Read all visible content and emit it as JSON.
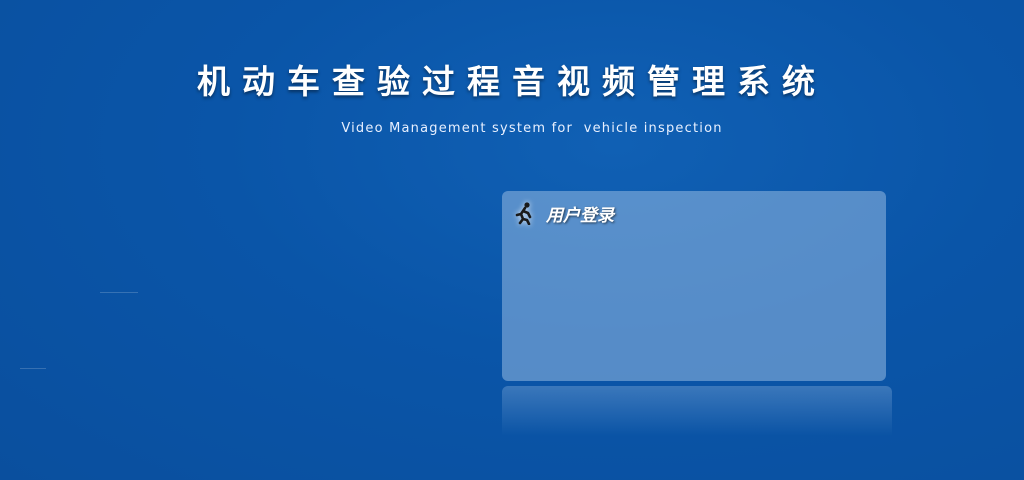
{
  "header": {
    "title": "机动车查验过程音视频管理系统",
    "subtitle": "Video Management system for  vehicle inspection"
  },
  "login": {
    "title": "用户登录",
    "icon": "runner-icon"
  }
}
